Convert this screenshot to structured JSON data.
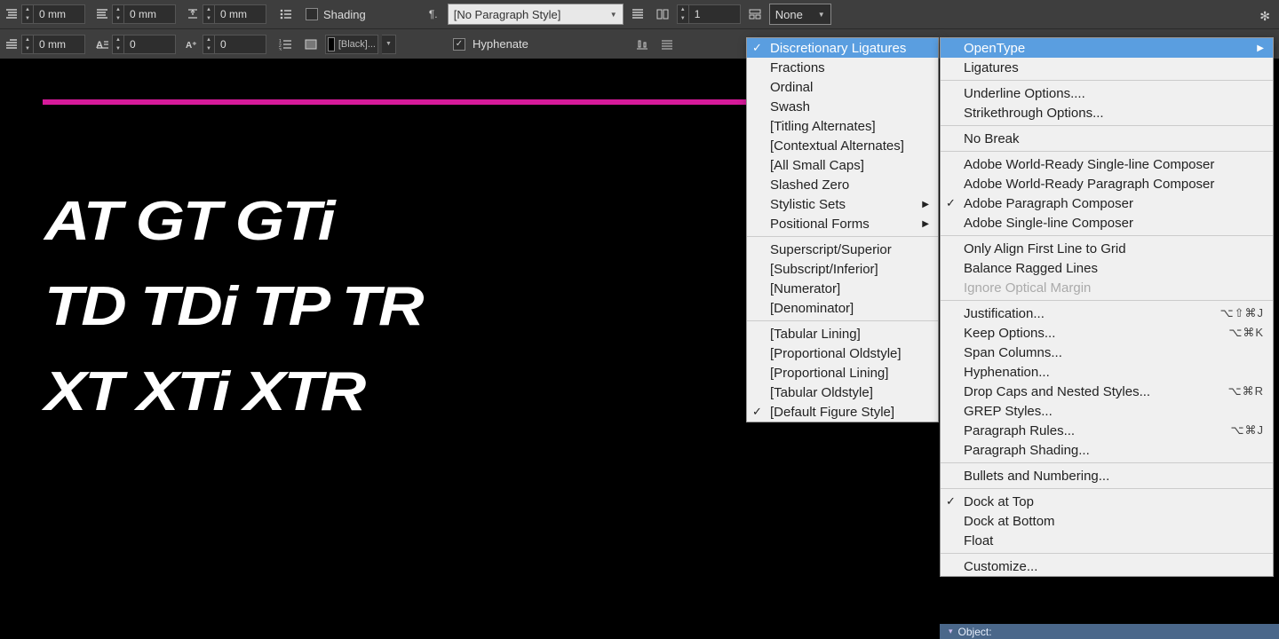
{
  "toolbar": {
    "row1": {
      "left_indent": "0 mm",
      "right_indent": "0 mm",
      "space_before": "0 mm",
      "shading_label": "Shading",
      "para_style": "[No Paragraph Style]",
      "columns_value": "1",
      "span_label": "None"
    },
    "row2": {
      "first_indent": "0 mm",
      "drop_lines": "0",
      "drop_chars": "0",
      "swatch_label": "[Black]...",
      "hyphenate_label": "Hyphenate"
    }
  },
  "canvas": {
    "line1": "AT GT GTi",
    "line2": "TD TDi TP TR",
    "line3": "XT XTi XTR"
  },
  "submenu": {
    "items": [
      {
        "label": "Discretionary Ligatures",
        "checked": true,
        "hl": true
      },
      {
        "label": "Fractions"
      },
      {
        "label": "Ordinal"
      },
      {
        "label": "Swash"
      },
      {
        "label": "[Titling Alternates]"
      },
      {
        "label": "[Contextual Alternates]"
      },
      {
        "label": "[All Small Caps]"
      },
      {
        "label": "Slashed Zero"
      },
      {
        "label": "Stylistic Sets",
        "arrow": true
      },
      {
        "label": "Positional Forms",
        "arrow": true
      },
      {
        "sep": true
      },
      {
        "label": "Superscript/Superior"
      },
      {
        "label": "[Subscript/Inferior]"
      },
      {
        "label": "[Numerator]"
      },
      {
        "label": "[Denominator]"
      },
      {
        "sep": true
      },
      {
        "label": "[Tabular Lining]"
      },
      {
        "label": "[Proportional Oldstyle]"
      },
      {
        "label": "[Proportional Lining]"
      },
      {
        "label": "[Tabular Oldstyle]"
      },
      {
        "label": "[Default Figure Style]",
        "checked": true
      }
    ]
  },
  "menu": {
    "items": [
      {
        "label": "OpenType",
        "arrow": true,
        "hl": true
      },
      {
        "label": "Ligatures"
      },
      {
        "sep": true
      },
      {
        "label": "Underline Options...."
      },
      {
        "label": "Strikethrough Options..."
      },
      {
        "sep": true
      },
      {
        "label": "No Break"
      },
      {
        "sep": true
      },
      {
        "label": "Adobe World-Ready Single-line Composer"
      },
      {
        "label": "Adobe World-Ready Paragraph Composer"
      },
      {
        "label": "Adobe Paragraph Composer",
        "checked": true
      },
      {
        "label": "Adobe Single-line Composer"
      },
      {
        "sep": true
      },
      {
        "label": "Only Align First Line to Grid"
      },
      {
        "label": "Balance Ragged Lines"
      },
      {
        "label": "Ignore Optical Margin",
        "dis": true
      },
      {
        "sep": true
      },
      {
        "label": "Justification...",
        "sc": "⌥⇧⌘J"
      },
      {
        "label": "Keep Options...",
        "sc": "⌥⌘K"
      },
      {
        "label": "Span Columns..."
      },
      {
        "label": "Hyphenation..."
      },
      {
        "label": "Drop Caps and Nested Styles...",
        "sc": "⌥⌘R"
      },
      {
        "label": "GREP Styles..."
      },
      {
        "label": "Paragraph Rules...",
        "sc": "⌥⌘J"
      },
      {
        "label": "Paragraph Shading..."
      },
      {
        "sep": true
      },
      {
        "label": "Bullets and Numbering..."
      },
      {
        "sep": true
      },
      {
        "label": "Dock at Top",
        "checked": true
      },
      {
        "label": "Dock at Bottom"
      },
      {
        "label": "Float"
      },
      {
        "sep": true
      },
      {
        "label": "Customize..."
      }
    ]
  },
  "panel": {
    "title": "Object:"
  }
}
